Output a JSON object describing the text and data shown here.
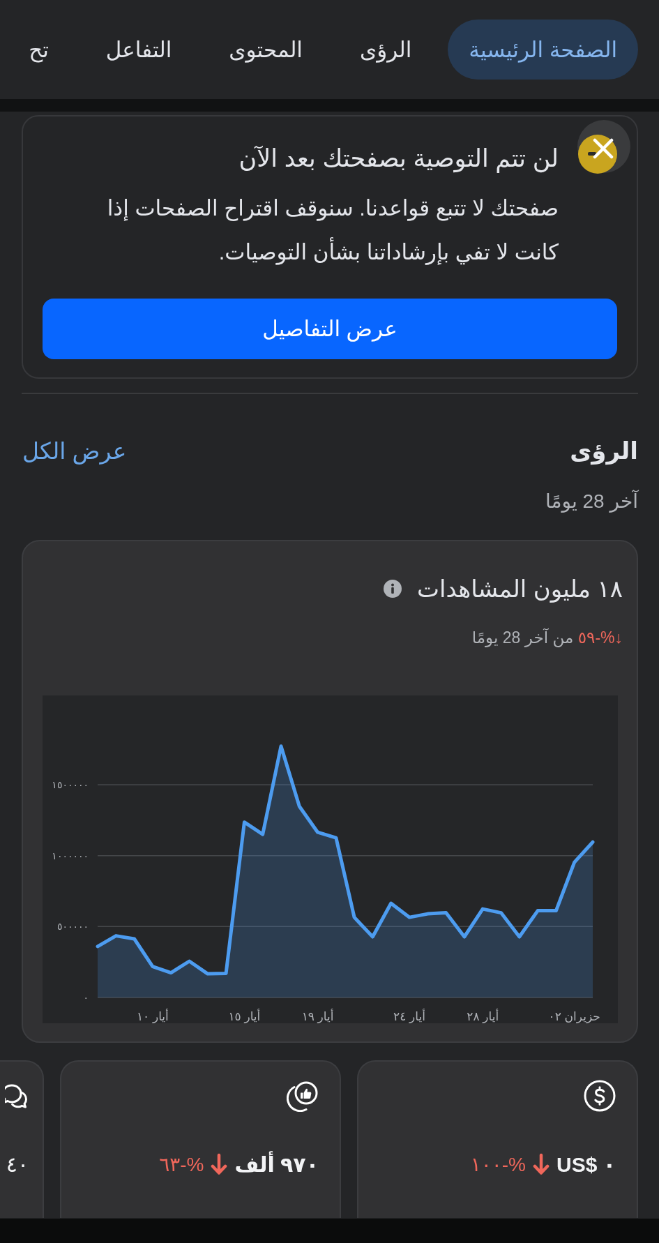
{
  "tabs": [
    {
      "label": "الصفحة الرئيسية",
      "selected": true
    },
    {
      "label": "الرؤى",
      "selected": false
    },
    {
      "label": "المحتوى",
      "selected": false
    },
    {
      "label": "التفاعل",
      "selected": false
    },
    {
      "label": "تح",
      "selected": false
    }
  ],
  "notice": {
    "title": "لن تتم التوصية بصفحتك بعد الآن",
    "body": "صفحتك لا تتبع قواعدنا. سنوقف اقتراح الصفحات إذا كانت لا تفي بإرشاداتنا بشأن التوصيات.",
    "button": "عرض التفاصيل"
  },
  "insights": {
    "title": "الرؤى",
    "link": "عرض الكل",
    "period": "آخر 28 يومًا",
    "views_card": {
      "value": "١٨ مليون المشاهدات",
      "negative": true,
      "change": "↓%-٥٩",
      "comparison": "من آخر 28 يومًا",
      "chart_data": {
        "type": "area",
        "grid": true,
        "categories": [
          null,
          null,
          null,
          "أيار ١٠",
          null,
          null,
          null,
          null,
          "أيار ١٥",
          null,
          null,
          null,
          "أيار ١٩",
          null,
          null,
          null,
          null,
          "أيار ٢٤",
          null,
          null,
          null,
          "أيار ٢٨",
          null,
          null,
          null,
          null,
          "حزيران ٠٢",
          null
        ],
        "series": [
          {
            "color": "#4d9cf0",
            "values": [
              360000,
              435000,
              413000,
              218000,
              174000,
              256000,
              167000,
              170000,
              1236000,
              1150000,
              1772000,
              1348000,
              1165000,
              1126000,
              565000,
              428000,
              664000,
              565000,
              590000,
              597000,
              428000,
              624000,
              597000,
              428000,
              612000,
              612000,
              954000,
              1096000
            ]
          }
        ],
        "ylim": [
          0,
          2130000
        ],
        "yticks": [
          {
            "value": 0,
            "label": "٠"
          },
          {
            "value": 500000,
            "label": "٥٠٠٠٠٠"
          },
          {
            "value": 1000000,
            "label": "١٠٠٠٠٠٠"
          },
          {
            "value": 1500000,
            "label": "١٥٠٠٠٠٠"
          }
        ]
      }
    }
  },
  "metric_cards": [
    {
      "kind": "earnings",
      "value": "US$ ٠",
      "negative": true,
      "change": "%-١٠٠"
    },
    {
      "kind": "engagement",
      "value": "٩٧٠ ألف",
      "negative": true,
      "change": "%-٦٣"
    },
    {
      "kind": "comments",
      "value": "٤٠"
    }
  ]
}
